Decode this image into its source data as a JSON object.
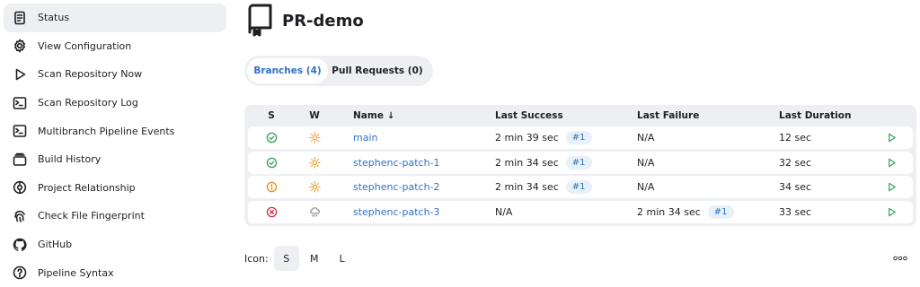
{
  "sidebar": {
    "items": [
      {
        "label": "Status",
        "icon": "document-icon",
        "active": true
      },
      {
        "label": "View Configuration",
        "icon": "gear-icon"
      },
      {
        "label": "Scan Repository Now",
        "icon": "play-icon"
      },
      {
        "label": "Scan Repository Log",
        "icon": "terminal-icon"
      },
      {
        "label": "Multibranch Pipeline Events",
        "icon": "terminal-icon"
      },
      {
        "label": "Build History",
        "icon": "history-icon"
      },
      {
        "label": "Project Relationship",
        "icon": "relationship-icon"
      },
      {
        "label": "Check File Fingerprint",
        "icon": "fingerprint-icon"
      },
      {
        "label": "GitHub",
        "icon": "github-icon"
      },
      {
        "label": "Pipeline Syntax",
        "icon": "help-icon"
      }
    ]
  },
  "header": {
    "title": "PR-demo",
    "icon": "repository-icon"
  },
  "tabs": [
    {
      "label": "Branches (4)",
      "active": true
    },
    {
      "label": "Pull Requests (0)",
      "active": false
    }
  ],
  "table": {
    "columns": {
      "s": "S",
      "w": "W",
      "name": "Name",
      "sort_indicator": "↓",
      "last_success": "Last Success",
      "last_failure": "Last Failure",
      "last_duration": "Last Duration"
    },
    "rows": [
      {
        "status": "success",
        "weather": "sunny",
        "name": "main",
        "last_success": "2 min 39 sec",
        "success_build": "#1",
        "last_failure": "N/A",
        "failure_build": "",
        "last_duration": "12 sec"
      },
      {
        "status": "success",
        "weather": "sunny",
        "name": "stephenc-patch-1",
        "last_success": "2 min 34 sec",
        "success_build": "#1",
        "last_failure": "N/A",
        "failure_build": "",
        "last_duration": "32 sec"
      },
      {
        "status": "unstable",
        "weather": "sunny",
        "name": "stephenc-patch-2",
        "last_success": "2 min 34 sec",
        "success_build": "#1",
        "last_failure": "N/A",
        "failure_build": "",
        "last_duration": "34 sec"
      },
      {
        "status": "failure",
        "weather": "stormy",
        "name": "stephenc-patch-3",
        "last_success": "N/A",
        "success_build": "",
        "last_failure": "2 min 34 sec",
        "failure_build": "#1",
        "last_duration": "33 sec"
      }
    ]
  },
  "footer": {
    "icon_label": "Icon:",
    "sizes": [
      {
        "label": "S",
        "active": true
      },
      {
        "label": "M",
        "active": false
      },
      {
        "label": "L",
        "active": false
      }
    ]
  },
  "colors": {
    "accent": "#2f72c4",
    "success": "#3a9e5c",
    "unstable": "#e8901c",
    "failure": "#d0314b",
    "sun": "#e8901c",
    "panel": "#eeeff2"
  }
}
